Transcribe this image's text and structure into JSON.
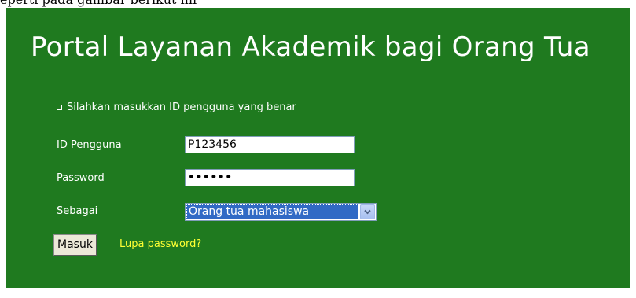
{
  "caption": "eperti pada gambar berikut ini",
  "portal": {
    "title": "Portal Layanan Akademik bagi Orang Tua",
    "notice": "Silahkan masukkan ID pengguna yang benar"
  },
  "form": {
    "user_id_label": "ID Pengguna",
    "user_id_value": "P123456",
    "password_label": "Password",
    "password_masked": "••••••",
    "role_label": "Sebagai",
    "role_selected": "Orang tua mahasiswa",
    "submit_label": "Masuk",
    "forgot_label": "Lupa password?"
  },
  "colors": {
    "panel_background": "#1f7a1f",
    "link": "#ffff33",
    "selection_highlight": "#316ac5"
  },
  "icons": {
    "notice_bullet": "square-bullet-icon",
    "select_arrow": "chevron-down-icon"
  }
}
